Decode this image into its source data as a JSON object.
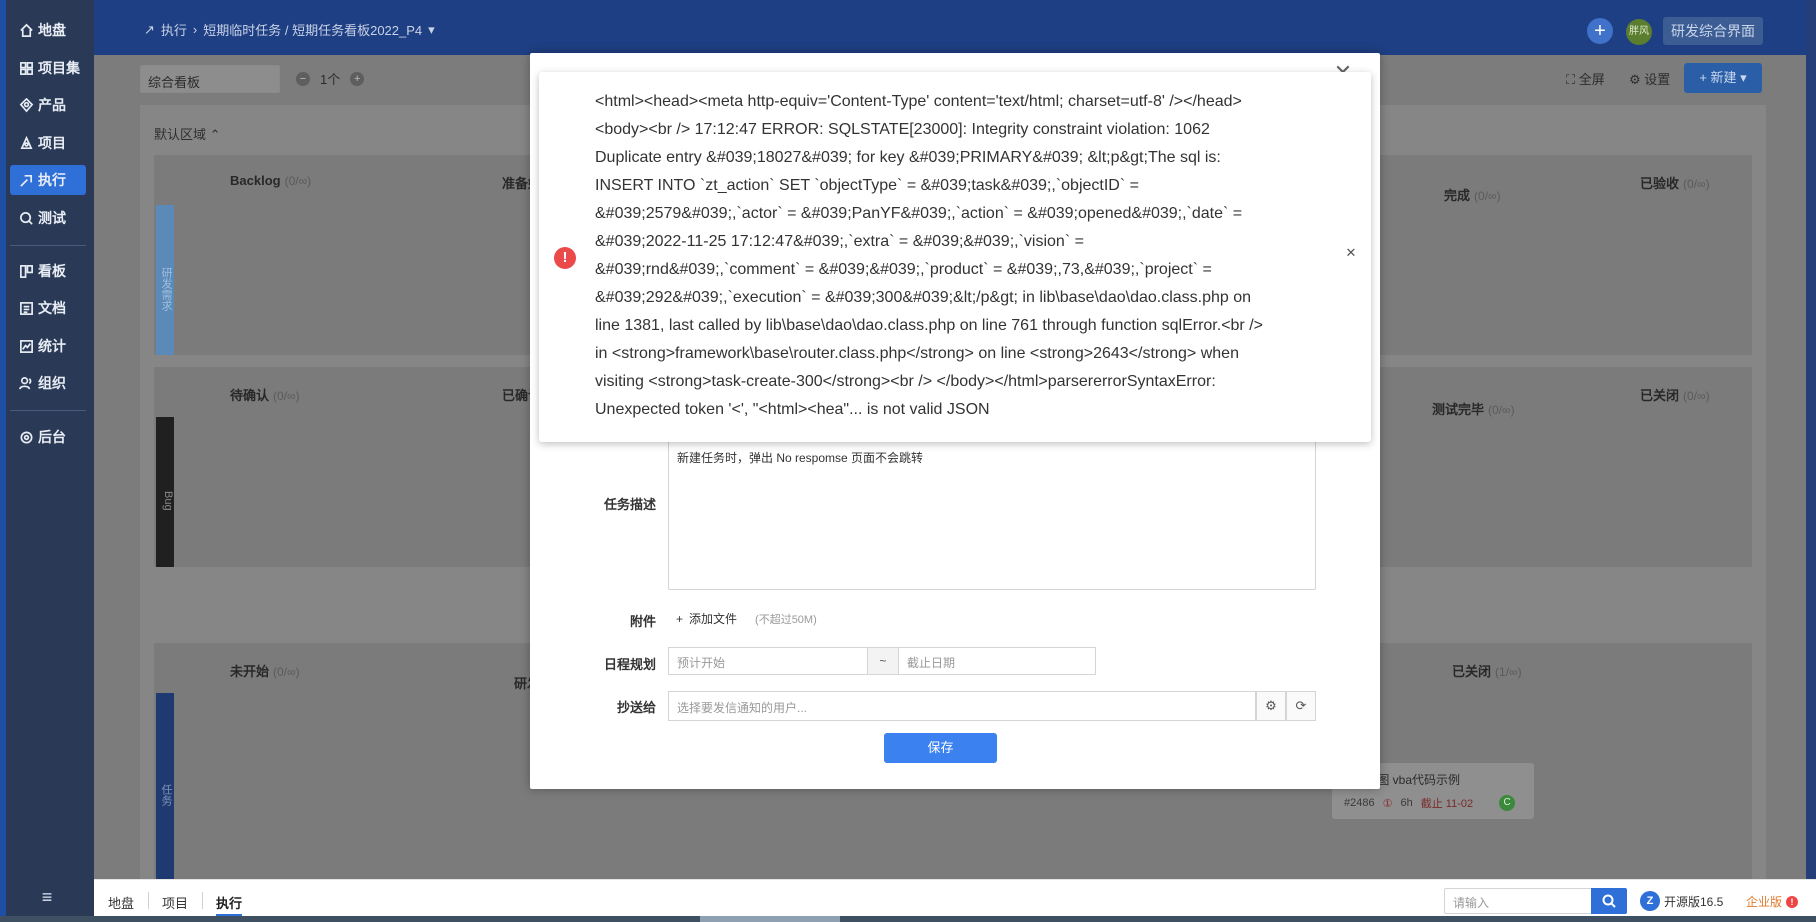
{
  "sidebar": {
    "items": [
      {
        "label": "地盘",
        "icon": "home-icon"
      },
      {
        "label": "项目集",
        "icon": "grid-icon"
      },
      {
        "label": "产品",
        "icon": "product-icon"
      },
      {
        "label": "项目",
        "icon": "project-icon"
      },
      {
        "label": "执行",
        "icon": "execution-icon",
        "active": true
      },
      {
        "label": "测试",
        "icon": "test-icon"
      },
      {
        "label": "看板",
        "icon": "kanban-icon"
      },
      {
        "label": "文档",
        "icon": "doc-icon"
      },
      {
        "label": "统计",
        "icon": "chart-icon"
      },
      {
        "label": "组织",
        "icon": "org-icon"
      },
      {
        "label": "后台",
        "icon": "settings-icon"
      }
    ],
    "menu_icon": "≡"
  },
  "header": {
    "breadcrumb_root": "执行",
    "breadcrumb_path": "短期临时任务 / 短期任务看板2022_P4",
    "avatar_text": "胖风",
    "workspace_button": "研发综合界面"
  },
  "toolbar": {
    "board_select": "综合看板",
    "count": "1个",
    "fullscreen": "全屏",
    "settings": "设置",
    "new_button": "新建"
  },
  "board": {
    "region_title": "默认区域",
    "lanes": [
      {
        "label": "研发需求",
        "cols": [
          {
            "name": "Backlog",
            "count": "0/∞"
          },
          {
            "name": "准备好"
          },
          {
            "name": "完成",
            "count": "0/∞"
          },
          {
            "name": "已验收",
            "count": "0/∞"
          }
        ]
      },
      {
        "label": "Bug",
        "cols": [
          {
            "name": "待确认",
            "count": "0/∞"
          },
          {
            "name": "已确认"
          },
          {
            "name": "测试完毕",
            "count": "0/∞"
          },
          {
            "name": "已关闭",
            "count": "0/∞"
          }
        ]
      },
      {
        "label": "任务",
        "cols": [
          {
            "name": "未开始",
            "count": "0/∞"
          },
          {
            "name": "研发中"
          },
          {
            "name": "已关闭",
            "count": "1/∞"
          }
        ]
      }
    ],
    "card": {
      "title": "el柱状图 vba代码示例",
      "id": "#2486",
      "hours": "6h",
      "due": "截止 11-02",
      "badge": "C"
    }
  },
  "modal": {
    "desc_label": "任务描述",
    "desc_value": "新建任务时，弹出  No respomse  页面不会跳转",
    "attach_label": "附件",
    "attach_link": "添加文件",
    "attach_hint": "(不超过50M)",
    "schedule_label": "日程规划",
    "start_placeholder": "预计开始",
    "tilde": "~",
    "end_placeholder": "截止日期",
    "cc_label": "抄送给",
    "cc_placeholder": "选择要发信通知的用户...",
    "save_label": "保存"
  },
  "error": {
    "message": "<html><head><meta http-equiv='Content-Type' content='text/html; charset=utf-8' /></head>\n<body><br /> 17:12:47 ERROR: SQLSTATE[23000]: Integrity constraint violation: 1062\nDuplicate entry &#039;18027&#039; for key &#039;PRIMARY&#039; &lt;p&gt;The sql is:\nINSERT INTO `zt_action` SET `objectType` = &#039;task&#039;,`objectID` =\n&#039;2579&#039;,`actor` = &#039;PanYF&#039;,`action` = &#039;opened&#039;,`date` =\n&#039;2022-11-25 17:12:47&#039;,`extra` = &#039;&#039;,`vision` =\n&#039;rnd&#039;,`comment` = &#039;&#039;,`product` = &#039;,73,&#039;,`project` =\n&#039;292&#039;,`execution` = &#039;300&#039;&lt;/p&gt; in lib\\base\\dao\\dao.class.php on\nline 1381, last called by lib\\base\\dao\\dao.class.php on line 761 through function sqlError.<br />\nin <strong>framework\\base\\router.class.php</strong> on line <strong>2643</strong> when\nvisiting <strong>task-create-300</strong><br /> </body></html>parsererrorSyntaxError:\nUnexpected token '<', \"<html><hea\"... is not valid JSON"
  },
  "bottombar": {
    "tabs": [
      "地盘",
      "项目",
      "执行"
    ],
    "search_placeholder": "请输入",
    "version": "开源版16.5",
    "enterprise": "企业版"
  },
  "colors": {
    "sidebar_bg": "#2a3a56",
    "accent": "#2f6fd8",
    "error_red": "#ea4a4a",
    "save_blue": "#3b82f0"
  }
}
